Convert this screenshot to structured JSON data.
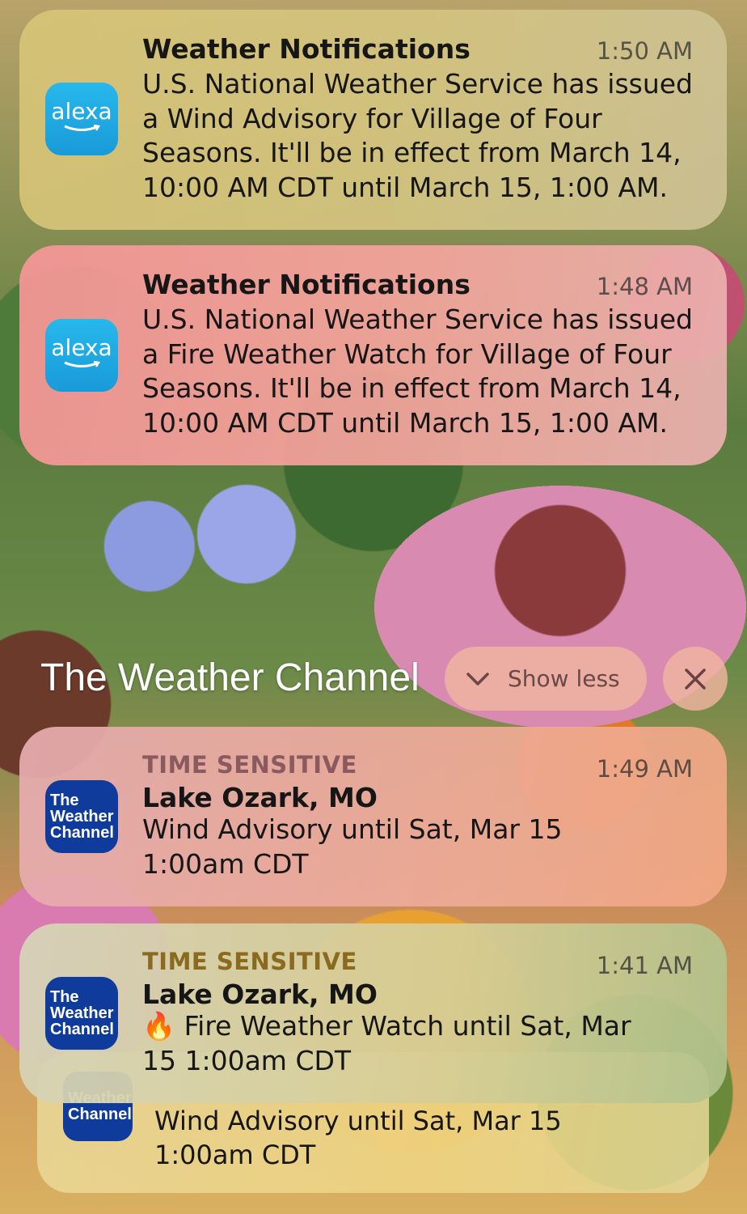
{
  "notifications": [
    {
      "app": "alexa",
      "icon": "alexa-icon",
      "icon_text": "alexa",
      "title": "Weather Notifications",
      "time": "1:50 AM",
      "body": "U.S. National Weather Service has issued a Wind Advisory for Village of Four Seasons. It'll be in effect from March 14, 10:00 AM CDT until March 15, 1:00 AM."
    },
    {
      "app": "alexa",
      "icon": "alexa-icon",
      "icon_text": "alexa",
      "title": "Weather Notifications",
      "time": "1:48 AM",
      "body": "U.S. National Weather Service has issued a Fire Weather Watch for Village of Four Seasons. It'll be in effect from March 14, 10:00 AM CDT until March 15, 1:00 AM."
    }
  ],
  "group": {
    "title": "The Weather Channel",
    "show_less_label": "Show less",
    "icon_text": [
      "The",
      "Weather",
      "Channel"
    ],
    "items": [
      {
        "label": "TIME SENSITIVE",
        "title": "Lake Ozark, MO",
        "time": "1:49 AM",
        "body": "Wind Advisory until Sat, Mar 15 1:00am CDT"
      },
      {
        "label": "TIME SENSITIVE",
        "title": "Lake Ozark, MO",
        "time": "1:41 AM",
        "emoji": "🔥",
        "body": "Fire Weather Watch until Sat, Mar 15 1:00am CDT"
      },
      {
        "body_line1": "Wind Advisory until Sat, Mar 15",
        "body_line2": "1:00am CDT"
      }
    ]
  },
  "colors": {
    "alexa_blue": "#1a9ad8",
    "twc_blue": "#0f3b9c",
    "time_sensitive_pink": "#8a5a5e",
    "time_sensitive_gold": "#8a6a1e"
  }
}
